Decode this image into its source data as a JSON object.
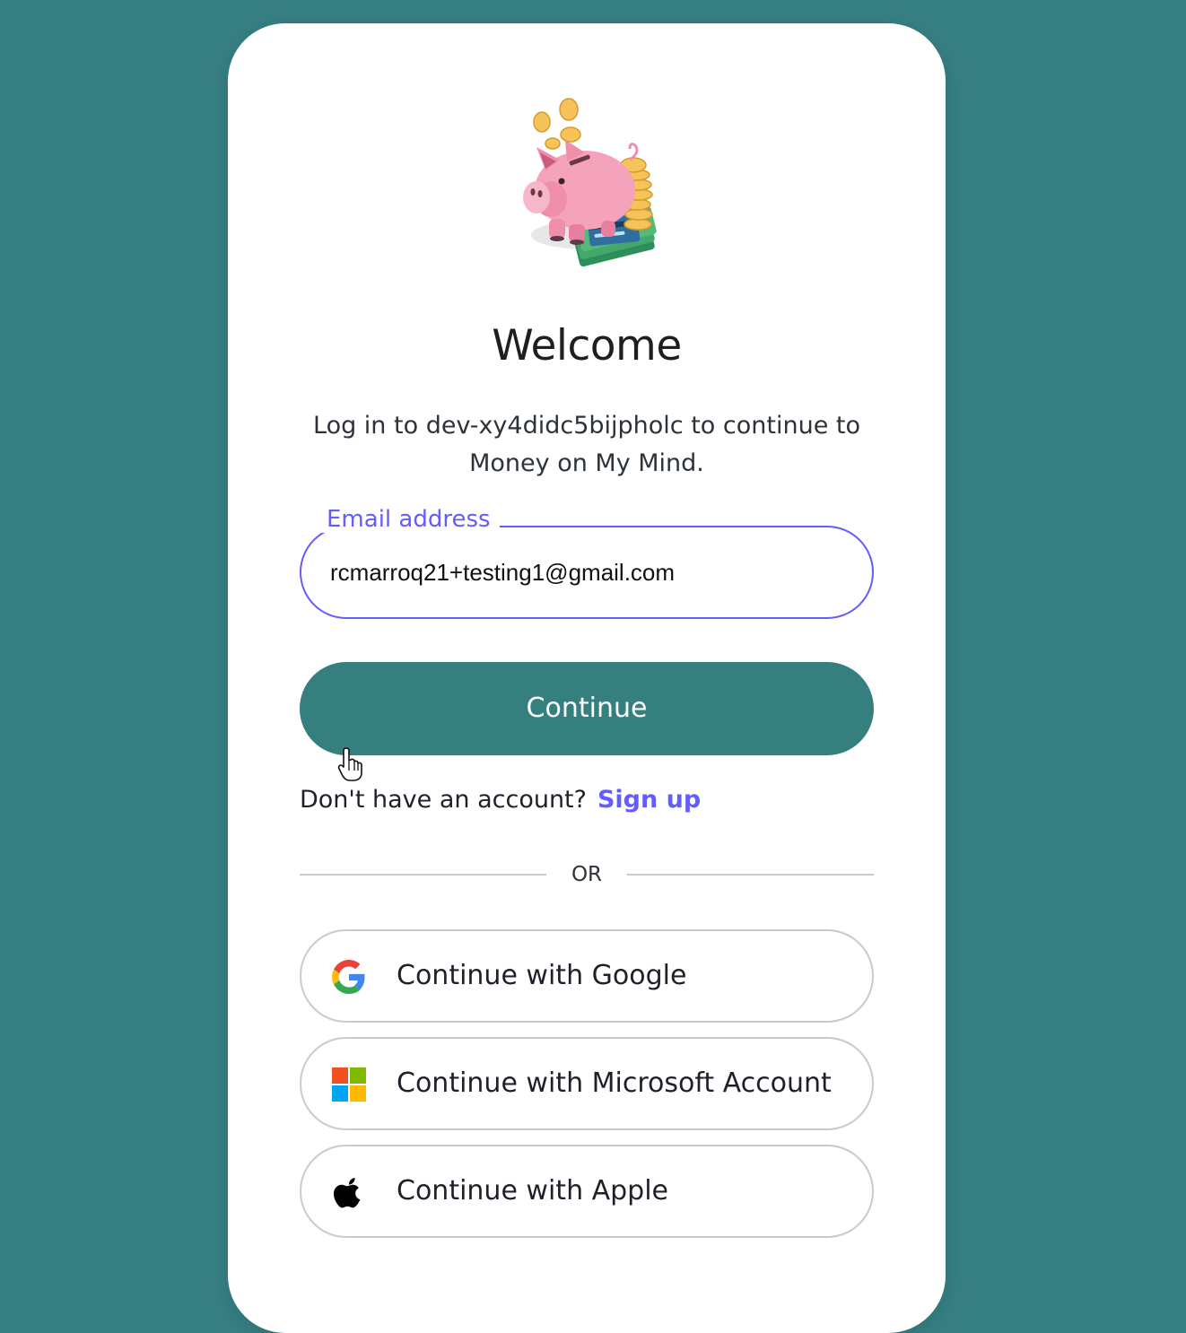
{
  "card": {
    "title": "Welcome",
    "subtitle": "Log in to dev-xy4didc5bijpholc to continue to Money on My Mind."
  },
  "email": {
    "label": "Email address",
    "value": "rcmarroq21+testing1@gmail.com"
  },
  "primary_button": {
    "label": "Continue"
  },
  "signup": {
    "prompt": "Don't have an account?",
    "link": "Sign up"
  },
  "divider": {
    "text": "OR"
  },
  "social_buttons": [
    {
      "label": "Continue with Google",
      "icon": "google-icon"
    },
    {
      "label": "Continue with Microsoft Account",
      "icon": "microsoft-icon"
    },
    {
      "label": "Continue with Apple",
      "icon": "apple-icon"
    }
  ],
  "colors": {
    "page_background": "#367f83",
    "primary": "#357f7f",
    "accent": "#635dff"
  }
}
